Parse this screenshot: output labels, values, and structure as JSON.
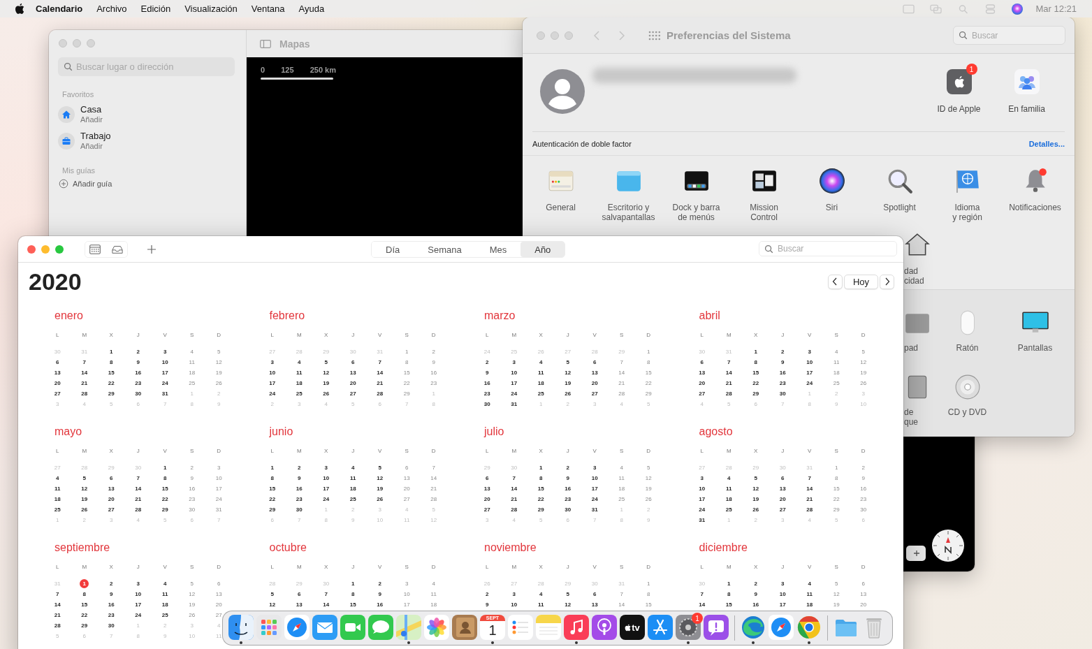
{
  "menubar": {
    "app": "Calendario",
    "menus": [
      "Archivo",
      "Edición",
      "Visualización",
      "Ventana",
      "Ayuda"
    ],
    "clock": "Mar 12:21"
  },
  "maps": {
    "title": "Mapas",
    "search": {
      "placeholder": "Buscar lugar o dirección"
    },
    "favorites_heading": "Favoritos",
    "favorites": [
      {
        "kind": "home",
        "name": "Casa",
        "action": "Añadir"
      },
      {
        "kind": "work",
        "name": "Trabajo",
        "action": "Añadir"
      }
    ],
    "guides_heading": "Mis guías",
    "add_guide": "Añadir guía",
    "scale": [
      "0",
      "125",
      "250 km"
    ]
  },
  "preferences": {
    "title": "Preferencias del Sistema",
    "search": {
      "placeholder": "Buscar"
    },
    "account_items": [
      {
        "kind": "apple-id",
        "label": "ID de Apple",
        "badge": "1"
      },
      {
        "kind": "family",
        "label": "En familia"
      }
    ],
    "notice": "Autenticación de doble factor",
    "notice_link": "Detalles...",
    "panes": [
      {
        "kind": "general",
        "label": "General"
      },
      {
        "kind": "desktop",
        "label": "Escritorio y\nsalvapantallas"
      },
      {
        "kind": "dock",
        "label": "Dock y barra\nde menús"
      },
      {
        "kind": "mission",
        "label": "Mission\nControl"
      },
      {
        "kind": "siri",
        "label": "Siri"
      },
      {
        "kind": "spotlight",
        "label": "Spotlight"
      },
      {
        "kind": "language",
        "label": "Idioma\ny región"
      },
      {
        "kind": "notifications",
        "label": "Notificaciones"
      }
    ],
    "covered_panes": [
      {
        "kind": "house",
        "label": "dad\ncidad"
      }
    ],
    "lower_rows": [
      [
        {
          "kind": "trackpad",
          "label": "pad"
        },
        {
          "kind": "mouse",
          "label": "Ratón"
        },
        {
          "kind": "display",
          "label": "Pantallas"
        }
      ],
      [
        {
          "kind": "drive",
          "label": "de\nque"
        },
        {
          "kind": "disc",
          "label": "CD y DVD"
        }
      ]
    ]
  },
  "calendar": {
    "views": [
      {
        "label": "Día",
        "selected": false
      },
      {
        "label": "Semana",
        "selected": false
      },
      {
        "label": "Mes",
        "selected": false
      },
      {
        "label": "Año",
        "selected": true
      }
    ],
    "search": {
      "placeholder": "Buscar"
    },
    "year": "2020",
    "today_button": "Hoy",
    "months": [
      {
        "name": "enero",
        "weekdays": [
          "L",
          "M",
          "X",
          "J",
          "V",
          "S",
          "D"
        ],
        "prev": [
          "30",
          "31"
        ],
        "days": [
          "1",
          "2",
          "3",
          "4",
          "5",
          "6",
          "7",
          "8",
          "9",
          "10",
          "11",
          "12",
          "13",
          "14",
          "15",
          "16",
          "17",
          "18",
          "19",
          "20",
          "21",
          "22",
          "23",
          "24",
          "25",
          "26",
          "27",
          "28",
          "29",
          "30",
          "31"
        ],
        "next": [
          "1",
          "2",
          "3",
          "4",
          "5",
          "6",
          "7",
          "8",
          "9"
        ]
      },
      {
        "name": "febrero",
        "weekdays": [
          "L",
          "M",
          "X",
          "J",
          "V",
          "S",
          "D"
        ],
        "prev": [
          "27",
          "28",
          "29",
          "30",
          "31"
        ],
        "days": [
          "1",
          "2",
          "3",
          "4",
          "5",
          "6",
          "7",
          "8",
          "9",
          "10",
          "11",
          "12",
          "13",
          "14",
          "15",
          "16",
          "17",
          "18",
          "19",
          "20",
          "21",
          "22",
          "23",
          "24",
          "25",
          "26",
          "27",
          "28",
          "29"
        ],
        "next": [
          "1",
          "2",
          "3",
          "4",
          "5",
          "6",
          "7",
          "8"
        ]
      },
      {
        "name": "marzo",
        "weekdays": [
          "L",
          "M",
          "X",
          "J",
          "V",
          "S",
          "D"
        ],
        "prev": [
          "24",
          "25",
          "26",
          "27",
          "28",
          "29"
        ],
        "days": [
          "1",
          "2",
          "3",
          "4",
          "5",
          "6",
          "7",
          "8",
          "9",
          "10",
          "11",
          "12",
          "13",
          "14",
          "15",
          "16",
          "17",
          "18",
          "19",
          "20",
          "21",
          "22",
          "23",
          "24",
          "25",
          "26",
          "27",
          "28",
          "29",
          "30",
          "31"
        ],
        "next": [
          "1",
          "2",
          "3",
          "4",
          "5"
        ]
      },
      {
        "name": "abril",
        "weekdays": [
          "L",
          "M",
          "X",
          "J",
          "V",
          "S",
          "D"
        ],
        "prev": [
          "30",
          "31"
        ],
        "days": [
          "1",
          "2",
          "3",
          "4",
          "5",
          "6",
          "7",
          "8",
          "9",
          "10",
          "11",
          "12",
          "13",
          "14",
          "15",
          "16",
          "17",
          "18",
          "19",
          "20",
          "21",
          "22",
          "23",
          "24",
          "25",
          "26",
          "27",
          "28",
          "29",
          "30"
        ],
        "next": [
          "1",
          "2",
          "3",
          "4",
          "5",
          "6",
          "7",
          "8",
          "9",
          "10"
        ]
      },
      {
        "name": "mayo",
        "weekdays": [
          "L",
          "M",
          "X",
          "J",
          "V",
          "S",
          "D"
        ],
        "prev": [
          "27",
          "28",
          "29",
          "30"
        ],
        "days": [
          "1",
          "2",
          "3",
          "4",
          "5",
          "6",
          "7",
          "8",
          "9",
          "10",
          "11",
          "12",
          "13",
          "14",
          "15",
          "16",
          "17",
          "18",
          "19",
          "20",
          "21",
          "22",
          "23",
          "24",
          "25",
          "26",
          "27",
          "28",
          "29",
          "30",
          "31"
        ],
        "next": [
          "1",
          "2",
          "3",
          "4",
          "5",
          "6",
          "7"
        ]
      },
      {
        "name": "junio",
        "weekdays": [
          "L",
          "M",
          "X",
          "J",
          "V",
          "S",
          "D"
        ],
        "days": [
          "1",
          "2",
          "3",
          "4",
          "5",
          "6",
          "7",
          "8",
          "9",
          "10",
          "11",
          "12",
          "13",
          "14",
          "15",
          "16",
          "17",
          "18",
          "19",
          "20",
          "21",
          "22",
          "23",
          "24",
          "25",
          "26",
          "27",
          "28",
          "29",
          "30"
        ],
        "next": [
          "1",
          "2",
          "3",
          "4",
          "5",
          "6",
          "7",
          "8",
          "9",
          "10",
          "11",
          "12"
        ]
      },
      {
        "name": "julio",
        "weekdays": [
          "L",
          "M",
          "X",
          "J",
          "V",
          "S",
          "D"
        ],
        "prev": [
          "29",
          "30"
        ],
        "days": [
          "1",
          "2",
          "3",
          "4",
          "5",
          "6",
          "7",
          "8",
          "9",
          "10",
          "11",
          "12",
          "13",
          "14",
          "15",
          "16",
          "17",
          "18",
          "19",
          "20",
          "21",
          "22",
          "23",
          "24",
          "25",
          "26",
          "27",
          "28",
          "29",
          "30",
          "31"
        ],
        "next": [
          "1",
          "2",
          "3",
          "4",
          "5",
          "6",
          "7",
          "8",
          "9"
        ]
      },
      {
        "name": "agosto",
        "weekdays": [
          "L",
          "M",
          "X",
          "J",
          "V",
          "S",
          "D"
        ],
        "prev": [
          "27",
          "28",
          "29",
          "30",
          "31"
        ],
        "days": [
          "1",
          "2",
          "3",
          "4",
          "5",
          "6",
          "7",
          "8",
          "9",
          "10",
          "11",
          "12",
          "13",
          "14",
          "15",
          "16",
          "17",
          "18",
          "19",
          "20",
          "21",
          "22",
          "23",
          "24",
          "25",
          "26",
          "27",
          "28",
          "29",
          "30",
          "31"
        ],
        "next": [
          "1",
          "2",
          "3",
          "4",
          "5",
          "6"
        ]
      },
      {
        "name": "septiembre",
        "weekdays": [
          "L",
          "M",
          "X",
          "J",
          "V",
          "S",
          "D"
        ],
        "prev": [
          "31"
        ],
        "today": "1",
        "days": [
          "2",
          "3",
          "4",
          "5",
          "6",
          "7",
          "8",
          "9",
          "10",
          "11",
          "12",
          "13",
          "14",
          "15",
          "16",
          "17",
          "18",
          "19",
          "20",
          "21",
          "22",
          "23",
          "24",
          "25",
          "26",
          "27",
          "28",
          "29",
          "30"
        ],
        "next": [
          "1",
          "2",
          "3",
          "4",
          "5",
          "6",
          "7",
          "8",
          "9",
          "10",
          "11"
        ]
      },
      {
        "name": "octubre",
        "weekdays": [
          "L",
          "M",
          "X",
          "J",
          "V",
          "S",
          "D"
        ],
        "prev": [
          "28",
          "29",
          "30"
        ],
        "days": [
          "1",
          "2",
          "3",
          "4",
          "5",
          "6",
          "7",
          "8",
          "9",
          "10",
          "11",
          "12",
          "13",
          "14",
          "15",
          "16",
          "17",
          "18"
        ]
      },
      {
        "name": "noviembre",
        "weekdays": [
          "L",
          "M",
          "X",
          "J",
          "V",
          "S",
          "D"
        ],
        "prev": [
          "26",
          "27",
          "28",
          "29",
          "30",
          "31"
        ],
        "days": [
          "1",
          "2",
          "3",
          "4",
          "5",
          "6",
          "7",
          "8",
          "9",
          "10",
          "11",
          "12",
          "13",
          "14",
          "15"
        ]
      },
      {
        "name": "diciembre",
        "weekdays": [
          "L",
          "M",
          "X",
          "J",
          "V",
          "S",
          "D"
        ],
        "prev": [
          "30"
        ],
        "days": [
          "1",
          "2",
          "3",
          "4",
          "5",
          "6",
          "7",
          "8",
          "9",
          "10",
          "11",
          "12",
          "13",
          "14",
          "15",
          "16",
          "17",
          "18",
          "19",
          "20"
        ]
      }
    ]
  },
  "dock": {
    "groups": [
      [
        {
          "kind": "finder",
          "running": true
        },
        {
          "kind": "launchpad",
          "running": false
        },
        {
          "kind": "safari",
          "running": false
        },
        {
          "kind": "mail",
          "running": false
        },
        {
          "kind": "facetime",
          "running": false
        },
        {
          "kind": "messages",
          "running": false
        },
        {
          "kind": "maps",
          "running": true
        },
        {
          "kind": "photos",
          "running": false
        },
        {
          "kind": "contacts",
          "running": false
        },
        {
          "kind": "calendar",
          "running": true,
          "month": "SEPT",
          "day": "1"
        },
        {
          "kind": "reminders",
          "running": false
        },
        {
          "kind": "notes",
          "running": false
        },
        {
          "kind": "music",
          "running": true
        },
        {
          "kind": "podcasts",
          "running": false
        },
        {
          "kind": "tv",
          "running": false,
          "label": "tv"
        },
        {
          "kind": "appstore",
          "running": false
        },
        {
          "kind": "settings",
          "running": true,
          "badge": "1"
        },
        {
          "kind": "feedback",
          "running": false
        }
      ],
      [
        {
          "kind": "edge",
          "running": true
        },
        {
          "kind": "safari",
          "running": false
        },
        {
          "kind": "chrome",
          "running": true
        }
      ],
      [
        {
          "kind": "folder",
          "running": false
        },
        {
          "kind": "trash",
          "running": false
        }
      ]
    ]
  }
}
